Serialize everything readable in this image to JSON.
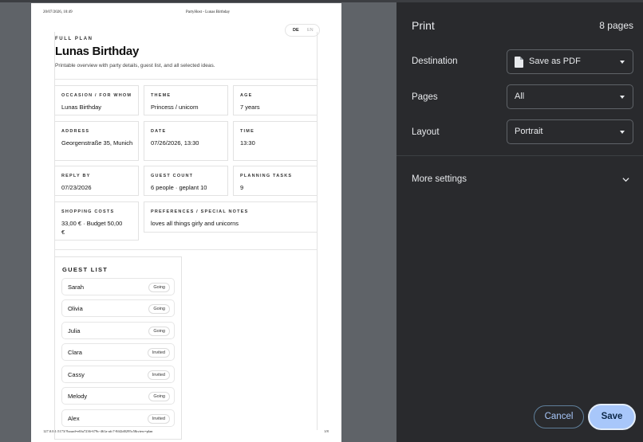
{
  "preview": {
    "header_datetime": "20/07/2026, 10:49",
    "header_title": "PartyHost - Lunas Birthday",
    "footer_url": "127.0.0.1:5173/?board=e0fa7236-679c-461a-afc7-8f42d0295c5&view=plan",
    "footer_page": "1/8",
    "plan": {
      "eyebrow": "FULL PLAN",
      "title": "Lunas Birthday",
      "subtitle": "Printable overview with party details, guest list, and all selected ideas.",
      "lang_de": "DE",
      "lang_en": "EN",
      "cards": [
        {
          "label": "OCCASION / FOR WHOM",
          "value": "Lunas Birthday"
        },
        {
          "label": "THEME",
          "value": "Princess / unicorn"
        },
        {
          "label": "AGE",
          "value": "7 years"
        },
        {
          "label": "ADDRESS",
          "value": "Georgenstraße 35, Munich"
        },
        {
          "label": "DATE",
          "value": "07/26/2026, 13:30"
        },
        {
          "label": "TIME",
          "value": "13:30"
        },
        {
          "label": "REPLY BY",
          "value": "07/23/2026"
        },
        {
          "label": "GUEST COUNT",
          "value": "6 people · geplant 10"
        },
        {
          "label": "PLANNING TASKS",
          "value": "9"
        },
        {
          "label": "SHOPPING COSTS",
          "value": "33,00 € · Budget 50,00 €"
        },
        {
          "label": "PREFERENCES / SPECIAL NOTES",
          "value": "loves all things girly and unicorns"
        }
      ],
      "guest_list_title": "GUEST LIST",
      "guests": [
        {
          "name": "Sarah",
          "status": "Going"
        },
        {
          "name": "Olivia",
          "status": "Going"
        },
        {
          "name": "Julia",
          "status": "Going"
        },
        {
          "name": "Clara",
          "status": "Invited"
        },
        {
          "name": "Cassy",
          "status": "Invited"
        },
        {
          "name": "Melody",
          "status": "Going"
        },
        {
          "name": "Alex",
          "status": "Invited"
        }
      ]
    }
  },
  "print_panel": {
    "title": "Print",
    "page_count": "8 pages",
    "destination_label": "Destination",
    "destination_value": "Save as PDF",
    "pages_label": "Pages",
    "pages_value": "All",
    "layout_label": "Layout",
    "layout_value": "Portrait",
    "more_settings": "More settings",
    "cancel_label": "Cancel",
    "save_label": "Save"
  },
  "colors": {
    "panel_bg": "#292a2d",
    "preview_bg": "#5f6368",
    "accent": "#a8c7fa"
  }
}
